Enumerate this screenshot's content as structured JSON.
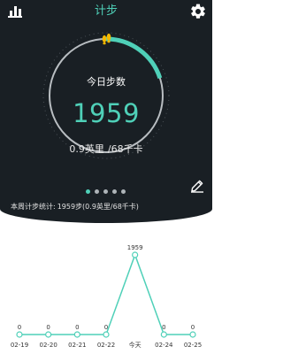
{
  "header": {
    "title": "计步",
    "stats_icon": "bar-chart-icon",
    "settings_icon": "gear-icon"
  },
  "dial": {
    "label": "今日步数",
    "steps": "1959",
    "distance": "0.9英里",
    "calories": "/68千卡",
    "goal_progress": 0.2,
    "shoe_icon": "footprints-icon"
  },
  "pager": {
    "total": 5,
    "active_index": 0
  },
  "edit_icon": "pencil-icon",
  "weekly_summary": {
    "label": "本周计步统计:",
    "value": "1959步(0.9英里/68千卡)"
  },
  "chart_data": {
    "type": "line",
    "x": [
      "02-19",
      "02-20",
      "02-21",
      "02-22",
      "今天",
      "02-24",
      "02-25"
    ],
    "values": [
      0,
      0,
      0,
      0,
      1959,
      0,
      0
    ],
    "data_labels": [
      "0",
      "0",
      "0",
      "0",
      "1959",
      "0",
      "0"
    ],
    "ylim": [
      0,
      1959
    ],
    "grid": false,
    "legend": "none"
  },
  "colors": {
    "accent": "#4fd0b8",
    "panel": "#191f24",
    "ring": "#b9bec2",
    "chart_line": "#4fd0b8",
    "dot_inactive": "#aeb4b8"
  }
}
